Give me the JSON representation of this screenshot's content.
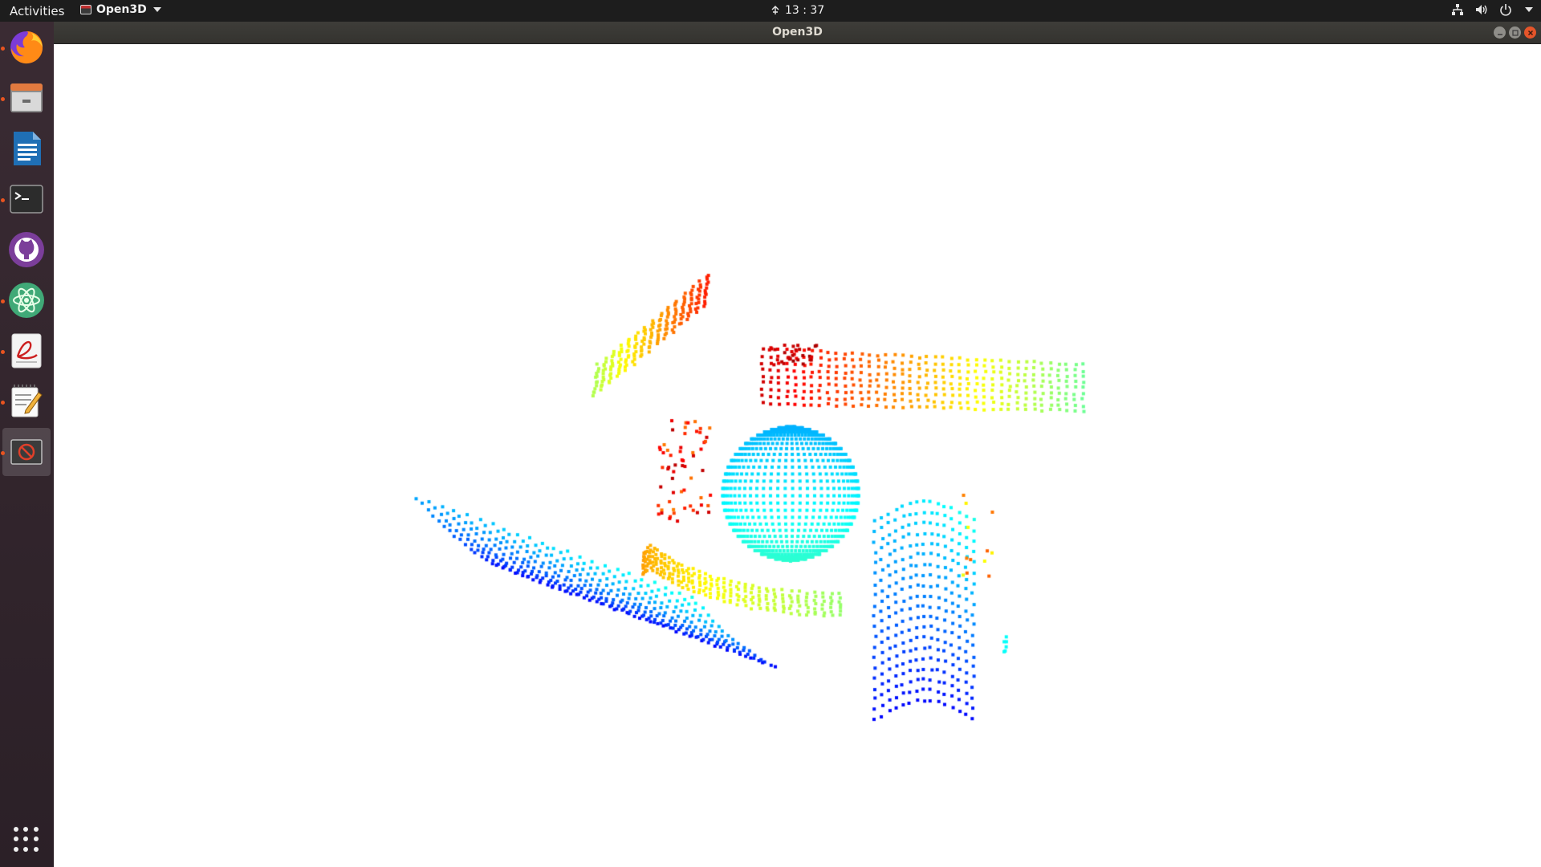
{
  "topbar": {
    "activities_label": "Activities",
    "app_name": "Open3D",
    "clock": "13 : 37",
    "tray_icons": [
      "network-icon",
      "volume-icon",
      "power-icon",
      "system-menu-caret-icon"
    ]
  },
  "window": {
    "title": "Open3D",
    "buttons": [
      "minimize",
      "maximize",
      "close"
    ]
  },
  "dock": {
    "apps": [
      {
        "name": "Firefox",
        "icon": "firefox-icon",
        "running": true
      },
      {
        "name": "Files",
        "icon": "files-icon",
        "running": true
      },
      {
        "name": "LibreOffice Writer",
        "icon": "writer-icon",
        "running": false
      },
      {
        "name": "Terminal",
        "icon": "terminal-icon",
        "running": true
      },
      {
        "name": "GitHub Desktop",
        "icon": "github-icon",
        "running": false
      },
      {
        "name": "Atom",
        "icon": "atom-icon",
        "running": true
      },
      {
        "name": "Document Viewer",
        "icon": "pdf-viewer-icon",
        "running": true
      },
      {
        "name": "Text Editor",
        "icon": "text-editor-icon",
        "running": true
      },
      {
        "name": "Open3D",
        "icon": "open3d-window-icon",
        "running": true,
        "active": true
      }
    ],
    "show_apps_icon": "app-grid-icon"
  },
  "colors": {
    "topbar": "#1d1d1d",
    "titlebar": "#3a3935",
    "dock": "#33262e",
    "accent": "#e95420",
    "viewport_bg": "#ffffff"
  },
  "scene": {
    "type": "point-cloud",
    "colormap": "jet",
    "objects": [
      "sphere",
      "left-cylinder",
      "right-cylinder",
      "upper-left-patch",
      "upper-right-patch",
      "floor-arc"
    ]
  }
}
